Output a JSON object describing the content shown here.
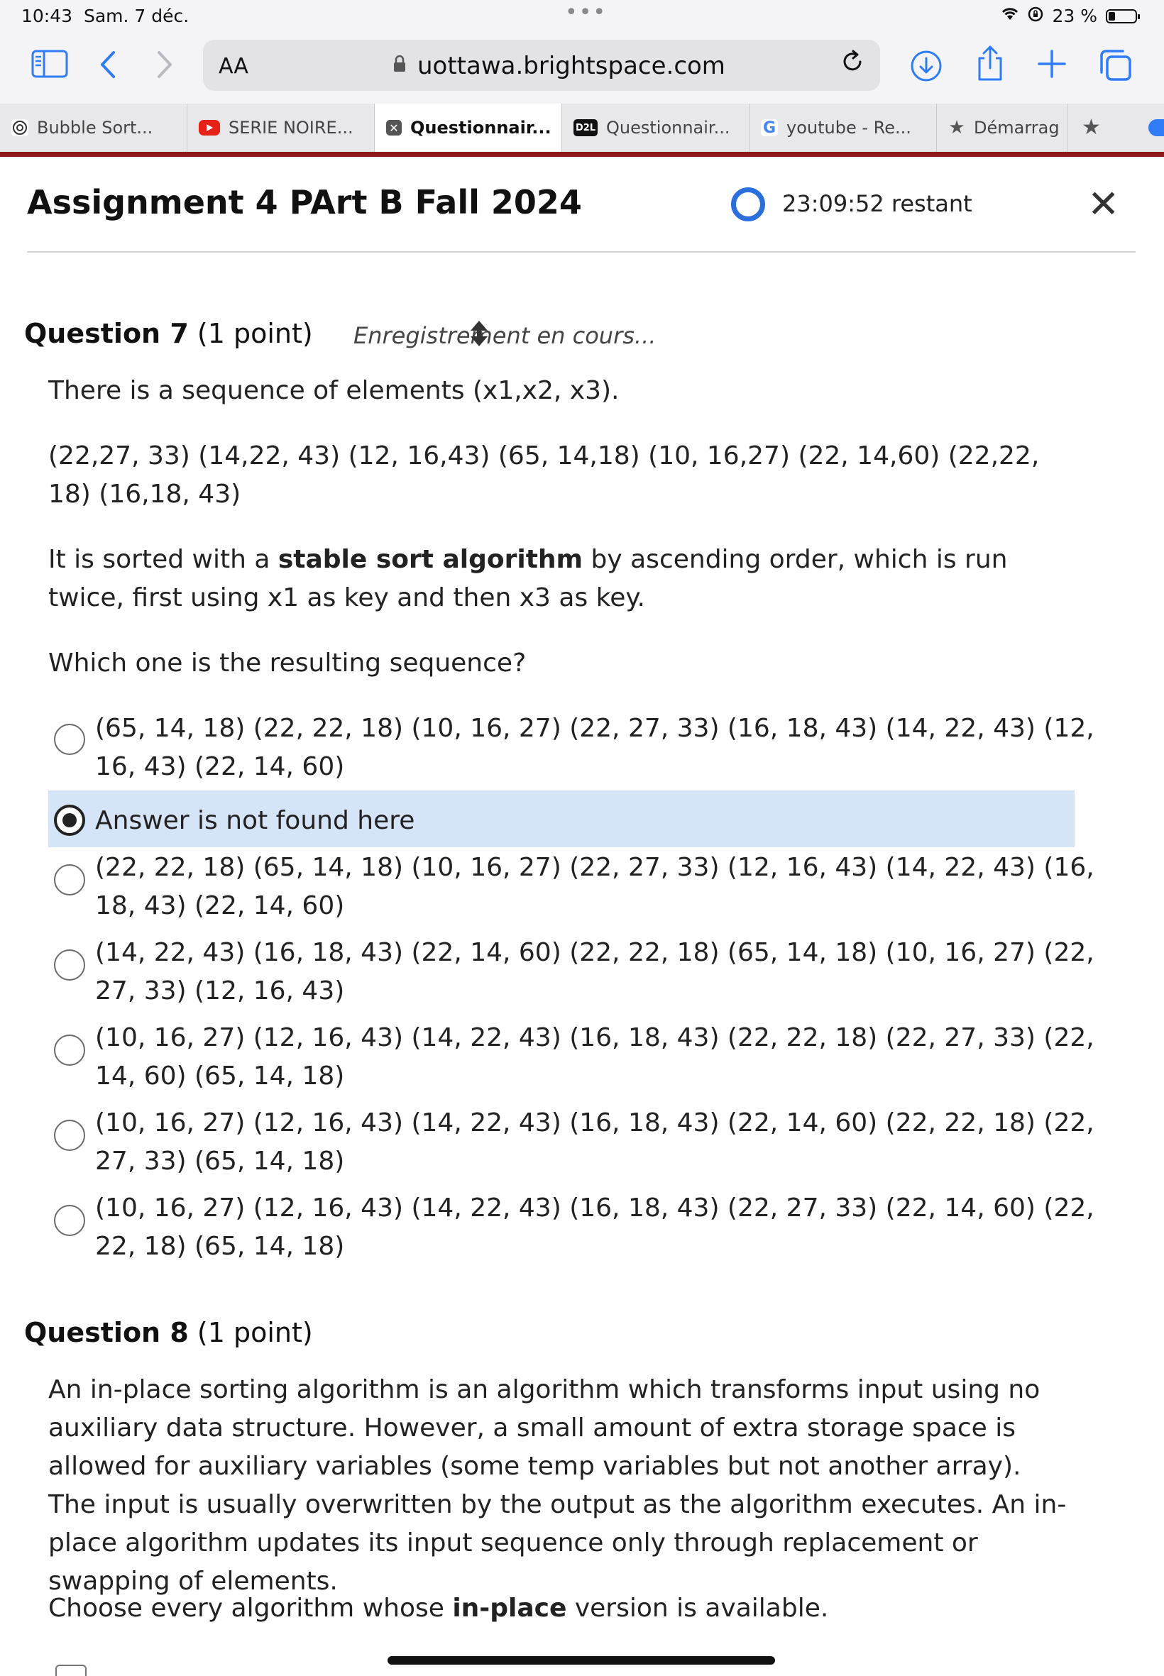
{
  "status_bar": {
    "time": "10:43",
    "date": "Sam. 7 déc.",
    "more_dots": "•••",
    "battery": "23 %"
  },
  "toolbar": {
    "text_size_label": "AA",
    "url": "uottawa.brightspace.com"
  },
  "tabs": [
    {
      "label": "Bubble Sort...",
      "icon": "openai-icon"
    },
    {
      "label": "SERIE NOIRE...",
      "icon": "youtube-icon"
    },
    {
      "label": "Questionnair...",
      "icon": "close-icon",
      "active": true
    },
    {
      "label": "Questionnair...",
      "icon": "d2l-icon",
      "icon_text": "D2L"
    },
    {
      "label": "youtube - Re...",
      "icon": "google-icon",
      "icon_text": "G"
    },
    {
      "label": "Démarrag",
      "icon": "star-icon"
    }
  ],
  "page": {
    "title": "Assignment 4 PArt B Fall 2024",
    "timer": "23:09:52 restant",
    "close": "✕"
  },
  "q7": {
    "number": "Question 7",
    "points": "(1 point)",
    "saving": "Enregistrement en cours...",
    "line1": "There is a sequence of elements (x1,x2, x3).",
    "sequence": "(22,27, 33) (14,22, 43) (12, 16,43) (65, 14,18) (10, 16,27) (22, 14,60) (22,22, 18) (16,18, 43)",
    "line3_pre": "It is sorted with a ",
    "line3_bold": "stable sort algorithm",
    "line3_post": " by ascending order, which is run twice, first using x1 as key and then x3 as key.",
    "prompt": "Which one is the resulting sequence?",
    "options": [
      {
        "label": "(65, 14, 18) (22, 22, 18)  (10, 16, 27) (22, 27, 33) (16, 18, 43)  (14, 22, 43) (12, 16, 43) (22, 14, 60)",
        "selected": false
      },
      {
        "label": "Answer is not found here",
        "selected": true
      },
      {
        "label": "(22, 22, 18) (65, 14, 18) (10, 16, 27) (22, 27, 33) (12, 16, 43) (14, 22, 43) (16, 18, 43) (22, 14, 60)",
        "selected": false
      },
      {
        "label": "(14, 22, 43) (16, 18, 43) (22, 14, 60) (22, 22, 18) (65, 14, 18) (10, 16, 27) (22, 27, 33) (12, 16, 43)",
        "selected": false
      },
      {
        "label": "(10, 16, 27) (12, 16, 43) (14, 22, 43) (16, 18, 43) (22, 22, 18) (22, 27, 33) (22, 14, 60) (65, 14, 18)",
        "selected": false
      },
      {
        "label": "(10, 16, 27) (12, 16, 43) (14, 22, 43) (16, 18, 43) (22, 14, 60) (22, 22, 18) (22, 27, 33) (65, 14, 18)",
        "selected": false
      },
      {
        "label": "(10, 16, 27) (12, 16, 43) (14, 22, 43) (16, 18, 43) (22, 27, 33) (22, 14, 60) (22, 22, 18) (65, 14, 18)",
        "selected": false
      }
    ]
  },
  "q8": {
    "number": "Question 8",
    "points": "(1 point)",
    "paragraph": "An in-place sorting algorithm is an algorithm which transforms input using no auxiliary data structure. However, a small amount of extra storage space is allowed for auxiliary variables (some temp variables but not another array). The input is usually overwritten by the output as the algorithm executes. An in-place algorithm updates its input sequence only through replacement or swapping of elements.",
    "prompt_pre": "Choose every algorithm whose ",
    "prompt_bold": "in-place",
    "prompt_post": " version is available."
  },
  "colors": {
    "accent": "#2f7cf6",
    "timer_ring": "#2a6fdb",
    "selected_option_bg": "#d6e4f7",
    "tab_separator_red": "#8b1a1a"
  }
}
